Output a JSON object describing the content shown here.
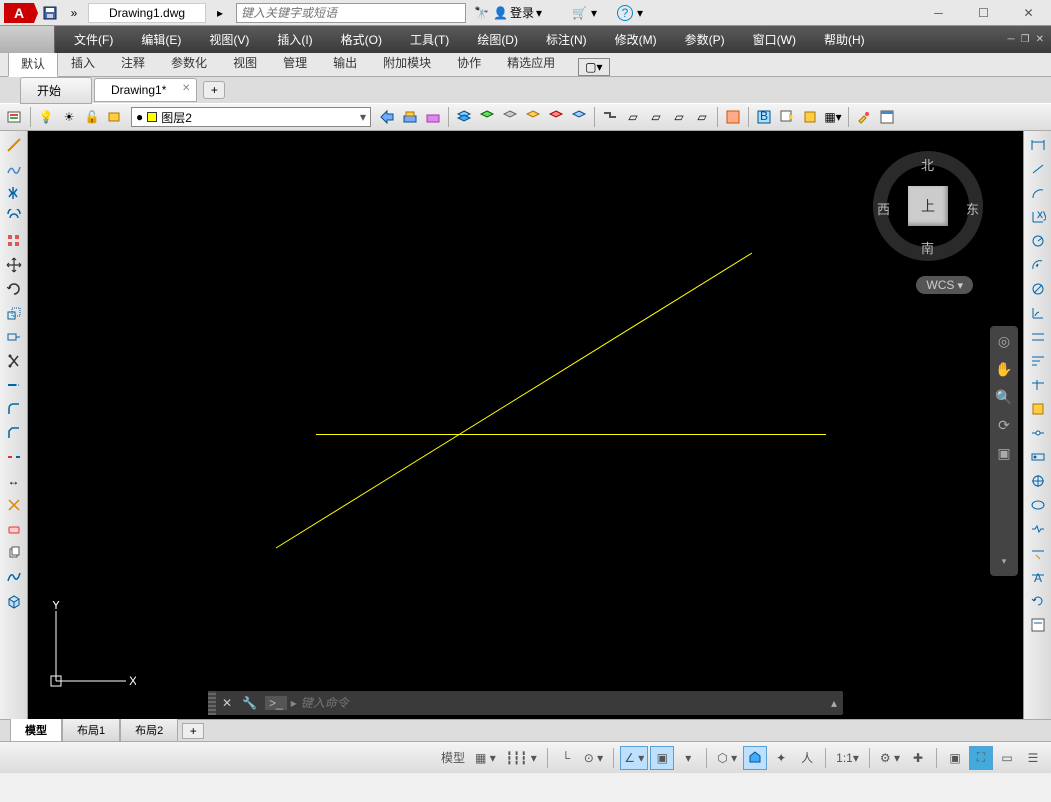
{
  "title": {
    "filename": "Drawing1.dwg",
    "search_placeholder": "键入关键字或短语",
    "login": "登录"
  },
  "menu": [
    "文件(F)",
    "编辑(E)",
    "视图(V)",
    "插入(I)",
    "格式(O)",
    "工具(T)",
    "绘图(D)",
    "标注(N)",
    "修改(M)",
    "参数(P)",
    "窗口(W)",
    "帮助(H)"
  ],
  "ribbon_tabs": [
    "默认",
    "插入",
    "注释",
    "参数化",
    "视图",
    "管理",
    "输出",
    "附加模块",
    "协作",
    "精选应用"
  ],
  "file_tabs": {
    "start": "开始",
    "doc": "Drawing1*"
  },
  "layer": {
    "current": "图层2"
  },
  "viewcube": {
    "n": "北",
    "s": "南",
    "e": "东",
    "w": "西",
    "face": "上",
    "wcs": "WCS"
  },
  "cmd": {
    "placeholder": "键入命令"
  },
  "layouts": {
    "model": "模型",
    "l1": "布局1",
    "l2": "布局2"
  },
  "status": {
    "model": "模型",
    "scale": "1:1"
  }
}
